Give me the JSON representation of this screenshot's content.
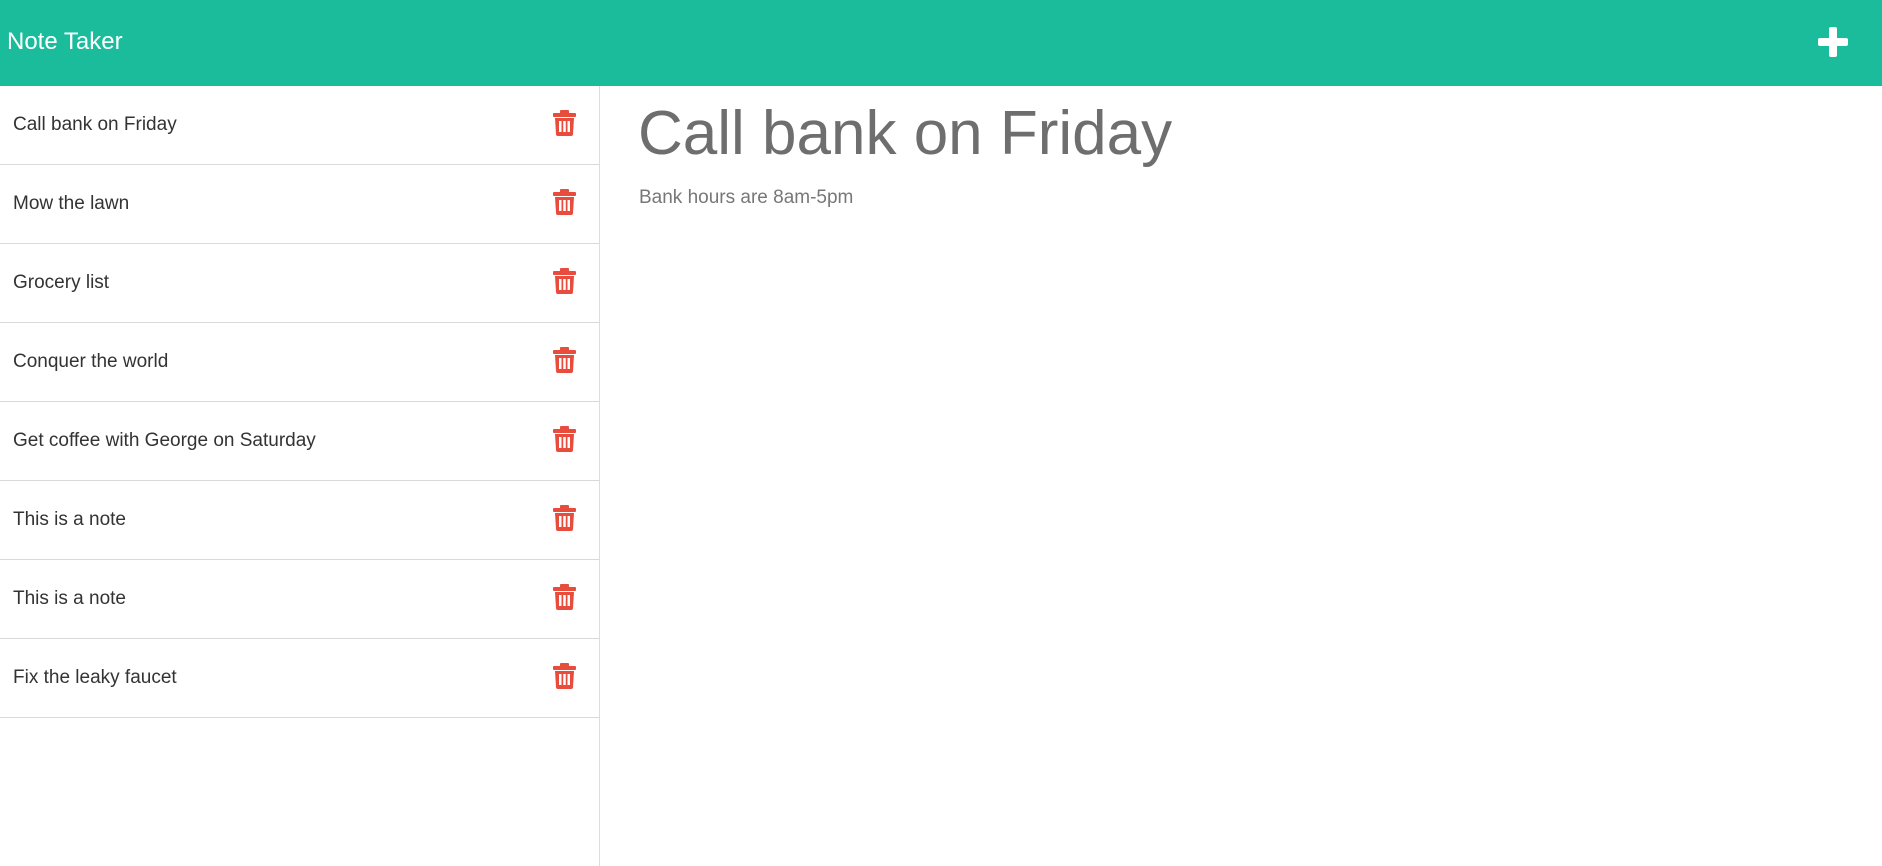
{
  "app": {
    "title": "Note Taker",
    "accent_color": "#1abc9c",
    "delete_color": "#e74c3c"
  },
  "header": {
    "new_note_icon": "plus-icon"
  },
  "notes": [
    {
      "title": "Call bank on Friday"
    },
    {
      "title": "Mow the lawn"
    },
    {
      "title": "Grocery list"
    },
    {
      "title": "Conquer the world"
    },
    {
      "title": "Get coffee with George on Saturday"
    },
    {
      "title": "This is a note"
    },
    {
      "title": "This is a note"
    },
    {
      "title": "Fix the leaky faucet"
    }
  ],
  "active_note": {
    "title": "Call bank on Friday",
    "text": "Bank hours are 8am-5pm"
  }
}
